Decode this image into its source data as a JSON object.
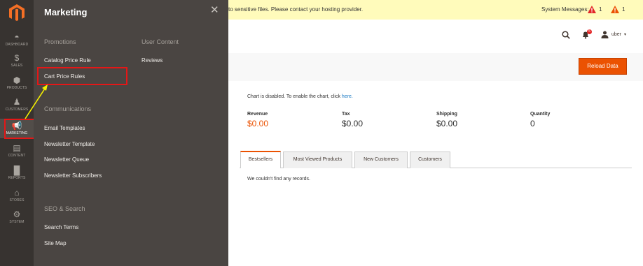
{
  "nav": {
    "items": [
      {
        "label": "DASHBOARD",
        "icon": "dashboard-icon"
      },
      {
        "label": "SALES",
        "icon": "dollar-icon"
      },
      {
        "label": "PRODUCTS",
        "icon": "cube-icon"
      },
      {
        "label": "CUSTOMERS",
        "icon": "person-icon"
      },
      {
        "label": "MARKETING",
        "icon": "megaphone-icon"
      },
      {
        "label": "CONTENT",
        "icon": "content-icon"
      },
      {
        "label": "REPORTS",
        "icon": "bar-chart-icon"
      },
      {
        "label": "STORES",
        "icon": "store-icon"
      },
      {
        "label": "SYSTEM",
        "icon": "gear-icon"
      }
    ]
  },
  "flyout": {
    "title": "Marketing",
    "groups": {
      "promotions": {
        "title": "Promotions",
        "links": [
          "Catalog Price Rule",
          "Cart Price Rules"
        ]
      },
      "user_content": {
        "title": "User Content",
        "links": [
          "Reviews"
        ]
      },
      "communications": {
        "title": "Communications",
        "links": [
          "Email Templates",
          "Newsletter Template",
          "Newsletter Queue",
          "Newsletter Subscribers"
        ]
      },
      "seo": {
        "title": "SEO & Search",
        "links": [
          "Search Terms",
          "Site Map"
        ]
      }
    }
  },
  "notice": {
    "text": "to sensitive files. Please contact your hosting provider.",
    "system_messages_label": "System Messages:",
    "critical_count": "1",
    "major_count": "1"
  },
  "header": {
    "notification_count": "5",
    "user_name": "uber"
  },
  "actions": {
    "reload_label": "Reload Data"
  },
  "dashboard": {
    "chart_note": "Chart is disabled. To enable the chart, click",
    "chart_link": "here.",
    "stats": [
      {
        "label": "Revenue",
        "value": "$0.00"
      },
      {
        "label": "Tax",
        "value": "$0.00"
      },
      {
        "label": "Shipping",
        "value": "$0.00"
      },
      {
        "label": "Quantity",
        "value": "0"
      }
    ],
    "tabs": [
      "Bestsellers",
      "Most Viewed Products",
      "New Customers",
      "Customers"
    ],
    "empty_message": "We couldn't find any records."
  },
  "colors": {
    "accent": "#eb5202",
    "nav_bg": "#373330",
    "flyout_bg": "#4a4542",
    "highlight": "#e41717",
    "arrow": "#f5f100"
  }
}
